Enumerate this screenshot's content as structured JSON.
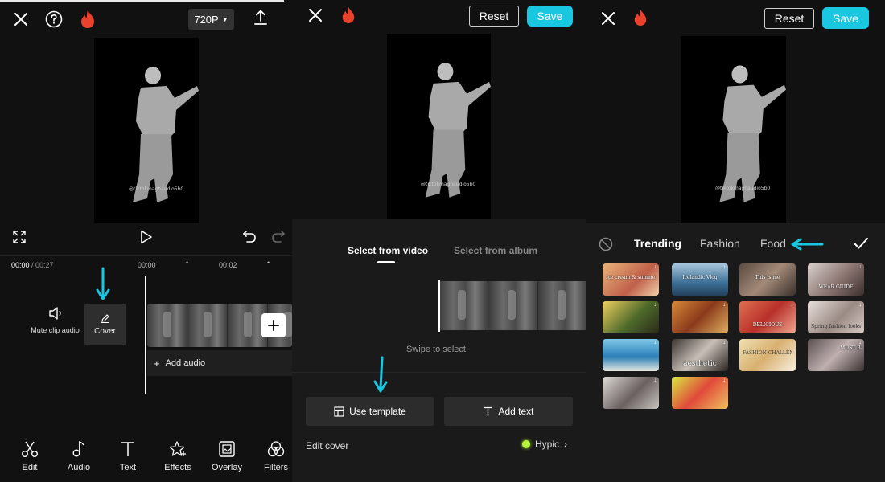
{
  "colors": {
    "accent": "#19c8e0",
    "fire": "#e8412c",
    "bg": "#111111"
  },
  "panel1": {
    "resolution": "720P",
    "time_current": "00:00",
    "time_total": " / 00:27",
    "ruler": [
      "00:00",
      "00:02"
    ],
    "mute_label": "Mute clip audio",
    "cover_label": "Cover",
    "add_audio_label": "Add audio",
    "watermark": "@tiktokmaghaudio5b0",
    "tools": [
      {
        "label": "Edit",
        "icon": "scissors-icon"
      },
      {
        "label": "Audio",
        "icon": "music-note-icon"
      },
      {
        "label": "Text",
        "icon": "text-icon"
      },
      {
        "label": "Effects",
        "icon": "effects-star-icon"
      },
      {
        "label": "Overlay",
        "icon": "overlay-icon"
      },
      {
        "label": "Filters",
        "icon": "filters-icon"
      }
    ]
  },
  "panel2": {
    "reset_label": "Reset",
    "save_label": "Save",
    "tab_video": "Select from video",
    "tab_album": "Select from album",
    "swipe_hint": "Swipe to select",
    "use_template_label": "Use template",
    "add_text_label": "Add text",
    "edit_cover_label": "Edit cover",
    "hypic_label": "Hypic",
    "watermark": "@tiktokmaghaudio5b0"
  },
  "panel3": {
    "reset_label": "Reset",
    "save_label": "Save",
    "tabs": [
      "Trending",
      "Fashion",
      "Food"
    ],
    "active_tab": "Trending",
    "watermark": "@tiktokmaghaudio5b0",
    "templates": [
      "Ice cream & summer cake",
      "Icelandic Vlog",
      "This is me",
      "WEAR GUIDE",
      "",
      "",
      "DELICIOUS",
      "Spring fashion looks",
      "",
      "aesthetic",
      "FASHION CHALLENGE",
      "MUST BUY",
      "",
      ""
    ]
  }
}
